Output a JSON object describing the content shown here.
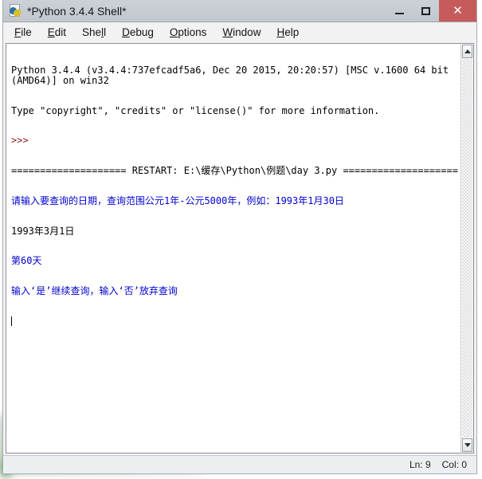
{
  "window": {
    "title": "*Python 3.4.4 Shell*",
    "icon": "python-logo-icon",
    "controls": {
      "minimize_label": "–",
      "maximize_label": "□",
      "close_label": "✕"
    },
    "close_color": "#c75b5b"
  },
  "backdrop": {
    "blurred_window_title": ""
  },
  "menubar": {
    "items": [
      {
        "label": "File",
        "accel": "F"
      },
      {
        "label": "Edit",
        "accel": "E"
      },
      {
        "label": "Shell",
        "accel": "l"
      },
      {
        "label": "Debug",
        "accel": "D"
      },
      {
        "label": "Options",
        "accel": "O"
      },
      {
        "label": "Window",
        "accel": "W"
      },
      {
        "label": "Help",
        "accel": "H"
      }
    ]
  },
  "console": {
    "lines": [
      {
        "text": "Python 3.4.4 (v3.4.4:737efcadf5a6, Dec 20 2015, 20:20:57) [MSC v.1600 64 bit (AMD64)] on win32",
        "color": "black"
      },
      {
        "text": "Type \"copyright\", \"credits\" or \"license()\" for more information.",
        "color": "black"
      },
      {
        "text": ">>>",
        "color": "prompt"
      },
      {
        "text": "==================== RESTART: E:\\缓存\\Python\\例题\\day 3.py ====================",
        "color": "black"
      },
      {
        "text": "请输入要查询的日期，查询范围公元1年-公元5000年，例如：1993年1月30日",
        "color": "blue"
      },
      {
        "text": "1993年3月1日",
        "color": "black"
      },
      {
        "text": "第60天",
        "color": "blue"
      },
      {
        "text": "输入‘是’继续查询，输入‘否’放弃查询",
        "color": "blue"
      }
    ],
    "colors": {
      "stdout": "#000000",
      "prompt": "#8b1a1a",
      "program_output": "#0000d0"
    }
  },
  "scrollbar": {
    "up_arrow": "arrow-up-icon",
    "down_arrow": "arrow-down-icon"
  },
  "statusbar": {
    "line": "Ln: 9",
    "column": "Col: 0"
  }
}
